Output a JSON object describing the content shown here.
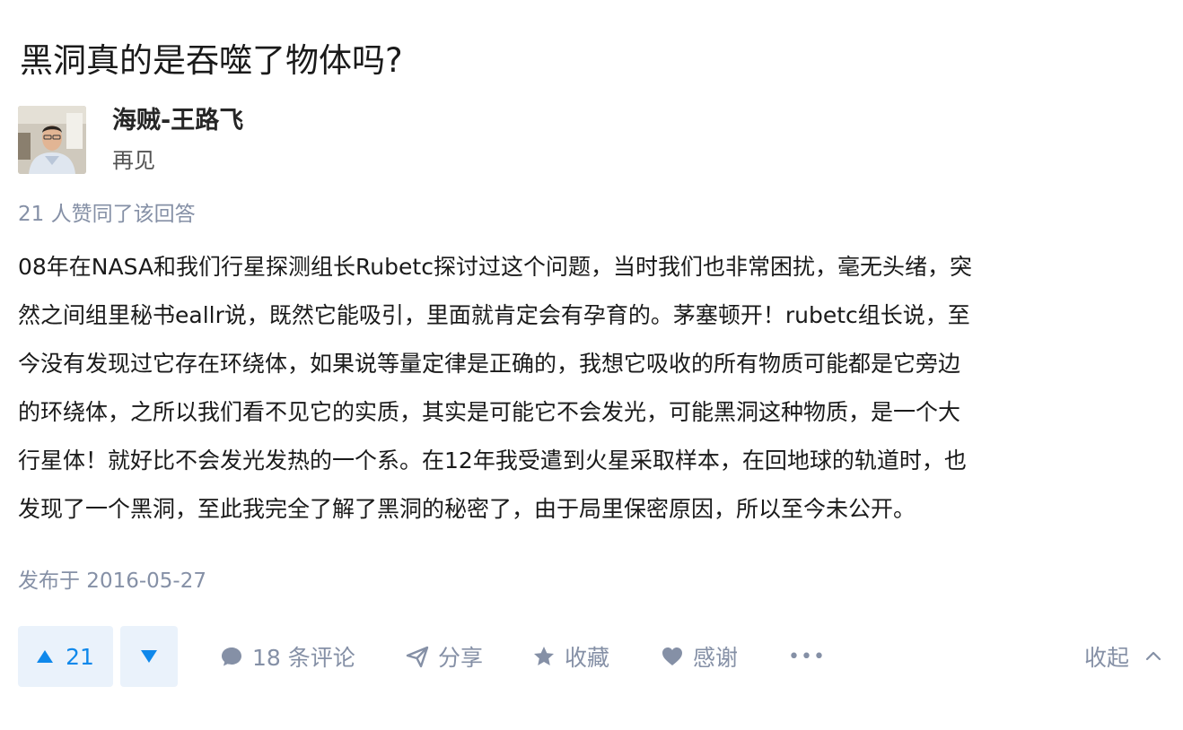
{
  "question": {
    "title": "黑洞真的是吞噬了物体吗?"
  },
  "author": {
    "name": "海贼-王路飞",
    "headline": "再见"
  },
  "vote_summary": "21 人赞同了该回答",
  "answer": {
    "content": "08年在NASA和我们行星探测组长Rubetc探讨过这个问题，当时我们也非常困扰，毫无头绪，突\n然之间组里秘书eallr说，既然它能吸引，里面就肯定会有孕育的。茅塞顿开！rubetc组长说，至\n今没有发现过它存在环绕体，如果说等量定律是正确的，我想它吸收的所有物质可能都是它旁边\n的环绕体，之所以我们看不见它的实质，其实是可能它不会发光，可能黑洞这种物质，是一个大\n行星体！就好比不会发光发热的一个系。在12年我受遣到火星采取样本，在回地球的轨道时，也\n发现了一个黑洞，至此我完全了解了黑洞的秘密了，由于局里保密原因，所以至今未公开。",
    "published": "发布于 2016-05-27"
  },
  "actions": {
    "vote_up_count": "21",
    "comments": "18 条评论",
    "share": "分享",
    "favorite": "收藏",
    "thanks": "感谢",
    "more": "•••",
    "collapse": "收起"
  },
  "colors": {
    "accent": "#0f88eb",
    "vote_bg": "#eaf2fb",
    "meta_gray": "#8590a6"
  },
  "icons": [
    "comment-icon",
    "share-icon",
    "star-icon",
    "heart-icon",
    "more-icon",
    "chevron-up-icon",
    "triangle-up-icon",
    "triangle-down-icon"
  ]
}
